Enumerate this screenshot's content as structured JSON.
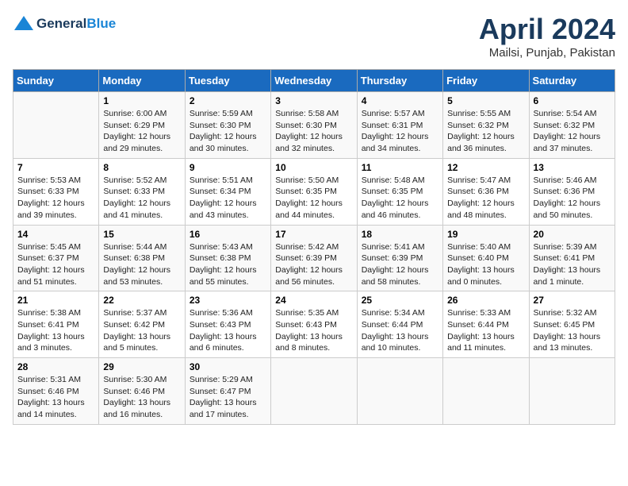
{
  "header": {
    "logo_line1": "General",
    "logo_line2": "Blue",
    "month_title": "April 2024",
    "location": "Mailsi, Punjab, Pakistan"
  },
  "days_of_week": [
    "Sunday",
    "Monday",
    "Tuesday",
    "Wednesday",
    "Thursday",
    "Friday",
    "Saturday"
  ],
  "weeks": [
    [
      {
        "day": "",
        "info": ""
      },
      {
        "day": "1",
        "info": "Sunrise: 6:00 AM\nSunset: 6:29 PM\nDaylight: 12 hours\nand 29 minutes."
      },
      {
        "day": "2",
        "info": "Sunrise: 5:59 AM\nSunset: 6:30 PM\nDaylight: 12 hours\nand 30 minutes."
      },
      {
        "day": "3",
        "info": "Sunrise: 5:58 AM\nSunset: 6:30 PM\nDaylight: 12 hours\nand 32 minutes."
      },
      {
        "day": "4",
        "info": "Sunrise: 5:57 AM\nSunset: 6:31 PM\nDaylight: 12 hours\nand 34 minutes."
      },
      {
        "day": "5",
        "info": "Sunrise: 5:55 AM\nSunset: 6:32 PM\nDaylight: 12 hours\nand 36 minutes."
      },
      {
        "day": "6",
        "info": "Sunrise: 5:54 AM\nSunset: 6:32 PM\nDaylight: 12 hours\nand 37 minutes."
      }
    ],
    [
      {
        "day": "7",
        "info": "Sunrise: 5:53 AM\nSunset: 6:33 PM\nDaylight: 12 hours\nand 39 minutes."
      },
      {
        "day": "8",
        "info": "Sunrise: 5:52 AM\nSunset: 6:33 PM\nDaylight: 12 hours\nand 41 minutes."
      },
      {
        "day": "9",
        "info": "Sunrise: 5:51 AM\nSunset: 6:34 PM\nDaylight: 12 hours\nand 43 minutes."
      },
      {
        "day": "10",
        "info": "Sunrise: 5:50 AM\nSunset: 6:35 PM\nDaylight: 12 hours\nand 44 minutes."
      },
      {
        "day": "11",
        "info": "Sunrise: 5:48 AM\nSunset: 6:35 PM\nDaylight: 12 hours\nand 46 minutes."
      },
      {
        "day": "12",
        "info": "Sunrise: 5:47 AM\nSunset: 6:36 PM\nDaylight: 12 hours\nand 48 minutes."
      },
      {
        "day": "13",
        "info": "Sunrise: 5:46 AM\nSunset: 6:36 PM\nDaylight: 12 hours\nand 50 minutes."
      }
    ],
    [
      {
        "day": "14",
        "info": "Sunrise: 5:45 AM\nSunset: 6:37 PM\nDaylight: 12 hours\nand 51 minutes."
      },
      {
        "day": "15",
        "info": "Sunrise: 5:44 AM\nSunset: 6:38 PM\nDaylight: 12 hours\nand 53 minutes."
      },
      {
        "day": "16",
        "info": "Sunrise: 5:43 AM\nSunset: 6:38 PM\nDaylight: 12 hours\nand 55 minutes."
      },
      {
        "day": "17",
        "info": "Sunrise: 5:42 AM\nSunset: 6:39 PM\nDaylight: 12 hours\nand 56 minutes."
      },
      {
        "day": "18",
        "info": "Sunrise: 5:41 AM\nSunset: 6:39 PM\nDaylight: 12 hours\nand 58 minutes."
      },
      {
        "day": "19",
        "info": "Sunrise: 5:40 AM\nSunset: 6:40 PM\nDaylight: 13 hours\nand 0 minutes."
      },
      {
        "day": "20",
        "info": "Sunrise: 5:39 AM\nSunset: 6:41 PM\nDaylight: 13 hours\nand 1 minute."
      }
    ],
    [
      {
        "day": "21",
        "info": "Sunrise: 5:38 AM\nSunset: 6:41 PM\nDaylight: 13 hours\nand 3 minutes."
      },
      {
        "day": "22",
        "info": "Sunrise: 5:37 AM\nSunset: 6:42 PM\nDaylight: 13 hours\nand 5 minutes."
      },
      {
        "day": "23",
        "info": "Sunrise: 5:36 AM\nSunset: 6:43 PM\nDaylight: 13 hours\nand 6 minutes."
      },
      {
        "day": "24",
        "info": "Sunrise: 5:35 AM\nSunset: 6:43 PM\nDaylight: 13 hours\nand 8 minutes."
      },
      {
        "day": "25",
        "info": "Sunrise: 5:34 AM\nSunset: 6:44 PM\nDaylight: 13 hours\nand 10 minutes."
      },
      {
        "day": "26",
        "info": "Sunrise: 5:33 AM\nSunset: 6:44 PM\nDaylight: 13 hours\nand 11 minutes."
      },
      {
        "day": "27",
        "info": "Sunrise: 5:32 AM\nSunset: 6:45 PM\nDaylight: 13 hours\nand 13 minutes."
      }
    ],
    [
      {
        "day": "28",
        "info": "Sunrise: 5:31 AM\nSunset: 6:46 PM\nDaylight: 13 hours\nand 14 minutes."
      },
      {
        "day": "29",
        "info": "Sunrise: 5:30 AM\nSunset: 6:46 PM\nDaylight: 13 hours\nand 16 minutes."
      },
      {
        "day": "30",
        "info": "Sunrise: 5:29 AM\nSunset: 6:47 PM\nDaylight: 13 hours\nand 17 minutes."
      },
      {
        "day": "",
        "info": ""
      },
      {
        "day": "",
        "info": ""
      },
      {
        "day": "",
        "info": ""
      },
      {
        "day": "",
        "info": ""
      }
    ]
  ]
}
